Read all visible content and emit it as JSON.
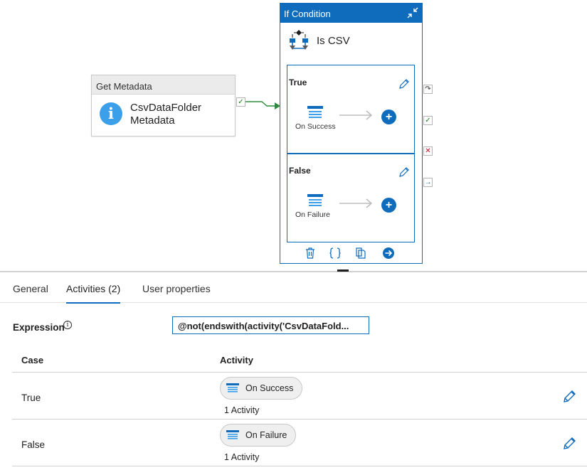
{
  "canvas": {
    "get_metadata": {
      "header": "Get Metadata",
      "name": "CsvDataFolder Metadata"
    },
    "if_condition": {
      "header": "If Condition",
      "title": "Is CSV",
      "branches": [
        {
          "label": "True",
          "activity": "On Success"
        },
        {
          "label": "False",
          "activity": "On Failure"
        }
      ]
    }
  },
  "tabs": [
    {
      "label": "General",
      "active": false
    },
    {
      "label": "Activities (2)",
      "active": true
    },
    {
      "label": "User properties",
      "active": false
    }
  ],
  "expression": {
    "label": "Expression",
    "value": "@not(endswith(activity('CsvDataFold..."
  },
  "table": {
    "headers": [
      "Case",
      "Activity"
    ],
    "rows": [
      {
        "case": "True",
        "activity": "On Success",
        "count": "1 Activity"
      },
      {
        "case": "False",
        "activity": "On Failure",
        "count": "1 Activity"
      }
    ]
  },
  "colors": {
    "accent": "#0f6cbd",
    "success": "#107c10",
    "failure": "#c50f1f",
    "info": "#3b9fea"
  }
}
